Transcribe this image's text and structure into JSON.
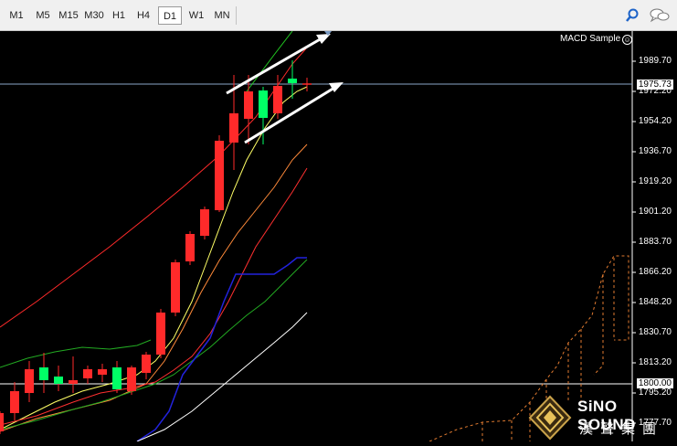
{
  "toolbar": {
    "timeframes": [
      "M1",
      "M5",
      "M15",
      "M30",
      "H1",
      "H4",
      "D1",
      "W1",
      "MN"
    ],
    "active": "D1",
    "icons": [
      "search-icon",
      "chat-icon"
    ]
  },
  "indicator": {
    "name": "MACD Sample",
    "icon": "smiley-icon"
  },
  "price_axis": {
    "ticks": [
      "1989.70",
      "1972.20",
      "1954.20",
      "1936.70",
      "1919.20",
      "1901.20",
      "1883.70",
      "1866.20",
      "1848.20",
      "1830.70",
      "1813.20",
      "1795.20",
      "1777.70"
    ],
    "current_price": "1975.73",
    "level_price": "1800.00"
  },
  "watermark": {
    "name": "SiNO SOUND",
    "cn": "漢聲集團"
  },
  "colors": {
    "bull": "#00ff66",
    "bear": "#ff2a2a",
    "ma_fast": "#ffff66",
    "ma_mid": "#ff3030",
    "ma_slow": "#ff5050",
    "ma_blue": "#2222dd",
    "ma_green": "#228b22",
    "ma_white": "#ffffff"
  }
}
